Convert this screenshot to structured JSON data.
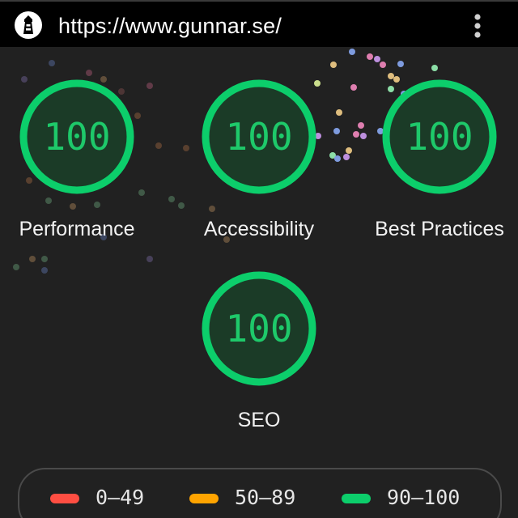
{
  "browser": {
    "url": "https://www.gunnar.se/",
    "logo_icon": "lighthouse-icon",
    "menu_icon": "more-vertical-icon"
  },
  "scores": [
    {
      "label": "Performance",
      "value": "100"
    },
    {
      "label": "Accessibility",
      "value": "100"
    },
    {
      "label": "Best Practices",
      "value": "100"
    },
    {
      "label": "SEO",
      "value": "100"
    }
  ],
  "legend": [
    {
      "range": "0–49",
      "color": "#ff4e42"
    },
    {
      "range": "50–89",
      "color": "#ffa400"
    },
    {
      "range": "90–100",
      "color": "#0cce6b"
    }
  ],
  "colors": {
    "background": "#212121",
    "pass_ring": "#0cce6b",
    "pass_fill": "#1b3b27",
    "pass_text": "#1ec96a"
  }
}
